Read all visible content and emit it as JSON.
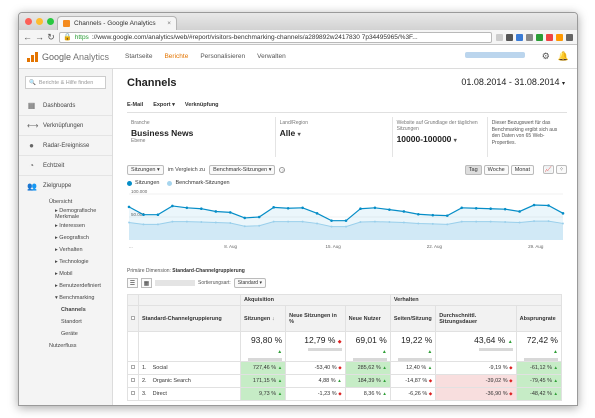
{
  "browser": {
    "tab_title": "Channels - Google Analytics",
    "url_https": "https",
    "url_rest": "://www.google.com/analytics/web/#report/visitors-benchmarking-channels/a289892w2417830 7p34495965/%3F...",
    "colors": {
      "close": "#fc5f57",
      "min": "#fdbc2e",
      "max": "#28c840"
    }
  },
  "ga": {
    "logo_main": "Google",
    "logo_sub": "Analytics",
    "nav": [
      "Startseite",
      "Berichte",
      "Personalisieren",
      "Verwalten"
    ],
    "active_nav": "Berichte",
    "accent": "#e37400"
  },
  "sidebar": {
    "search_placeholder": "Berichte & Hilfe finden",
    "items": [
      {
        "label": "Dashboards",
        "icon": "grid-icon"
      },
      {
        "label": "Verknüpfungen",
        "icon": "link-icon"
      },
      {
        "label": "Radar-Ereignisse",
        "icon": "pin-icon"
      },
      {
        "label": "Echtzeit",
        "icon": "clock-icon"
      },
      {
        "label": "Zielgruppe",
        "icon": "users-icon"
      }
    ],
    "sub": [
      {
        "label": "Übersicht",
        "level": 1
      },
      {
        "label": "▸ Demografische Merkmale",
        "level": 2
      },
      {
        "label": "▸ Interessen",
        "level": 2
      },
      {
        "label": "▸ Geografisch",
        "level": 2
      },
      {
        "label": "▸ Verhalten",
        "level": 2
      },
      {
        "label": "▸ Technologie",
        "level": 2
      },
      {
        "label": "▸ Mobil",
        "level": 2
      },
      {
        "label": "▸ Benutzerdefiniert",
        "level": 2
      },
      {
        "label": "▾ Benchmarking",
        "level": 2
      },
      {
        "label": "Channels",
        "level": 3,
        "selected": true
      },
      {
        "label": "Standort",
        "level": 3
      },
      {
        "label": "Geräte",
        "level": 3
      },
      {
        "label": "Nutzerfluss",
        "level": 1
      }
    ]
  },
  "main": {
    "title": "Channels",
    "date_range": "01.08.2014 - 31.08.2014",
    "toolbar": [
      "E-Mail",
      "Export ▾",
      "Verknüpfung"
    ],
    "filters": {
      "branche_label": "Branche",
      "branche_value": "Business News",
      "branche_sub": "Ebene",
      "land_label": "Land/Region",
      "land_value": "Alle",
      "sitzungen_label": "Website auf Grundlage der täglichen Sitzungen",
      "sitzungen_value": "10000-100000",
      "note": "Dieser Bezugswert für das Benchmarking ergibt sich aus den Daten von 65 Web-Properties."
    },
    "compare": {
      "metric1": "Sitzungen",
      "vs": "im Vergleich zu",
      "metric2": "Benchmark-Sitzungen"
    },
    "granularity": [
      "Tag",
      "Woche",
      "Monat"
    ],
    "active_granularity": "Tag",
    "legend": [
      {
        "label": "Sitzungen",
        "color": "#058dc7"
      },
      {
        "label": "Benchmark-Sitzungen",
        "color": "#a7d5ee"
      }
    ],
    "primary_dim_label": "Primäre Dimension:",
    "primary_dim_value": "Standard-Channelgruppierung",
    "sort_type_label": "Sortierungsart:",
    "sort_type_value": "Standard ▾",
    "table": {
      "groups": [
        "Akquisition",
        "Verhalten"
      ],
      "dim_header": "Standard-Channelgruppierung",
      "metric_headers": [
        "Sitzungen",
        "Neue Sitzungen in %",
        "Neue Nutzer",
        "Seiten/Sitzung",
        "Durchschnittl. Sitzungsdauer",
        "Absprungrate"
      ],
      "totals": [
        "93,80 %",
        "12,79 %",
        "69,01 %",
        "19,22 %",
        "43,64 %",
        "72,42 %"
      ],
      "total_dirs": [
        "up",
        "down",
        "up",
        "up",
        "up",
        "up"
      ],
      "rows": [
        {
          "idx": "1.",
          "name": "Social",
          "cells": [
            "727,46 %",
            "-53,40 %",
            "285,62 %",
            "12,40 %",
            "-9,19 %",
            "-61,12 %"
          ],
          "dirs": [
            "up",
            "down",
            "up",
            "up",
            "down",
            "up"
          ],
          "bg": [
            "g",
            "",
            "g",
            "",
            "",
            "g"
          ]
        },
        {
          "idx": "2.",
          "name": "Organic Search",
          "cells": [
            "171,15 %",
            "4,88 %",
            "184,39 %",
            "-14,87 %",
            "-39,02 %",
            "-79,45 %"
          ],
          "dirs": [
            "up",
            "up",
            "up",
            "down",
            "down",
            "up"
          ],
          "bg": [
            "g",
            "",
            "g",
            "",
            "r",
            "g"
          ]
        },
        {
          "idx": "3.",
          "name": "Direct",
          "cells": [
            "9,73 %",
            "-1,23 %",
            "8,36 %",
            "-6,26 %",
            "-36,90 %",
            "-48,42 %"
          ],
          "dirs": [
            "up",
            "down",
            "up",
            "down",
            "down",
            "up"
          ],
          "bg": [
            "g",
            "",
            "",
            "",
            "r",
            "g"
          ]
        }
      ]
    }
  },
  "chart_data": {
    "type": "line",
    "x": [
      "1. Aug",
      "2. Aug",
      "3. Aug",
      "4. Aug",
      "5. Aug",
      "6. Aug",
      "7. Aug",
      "8. Aug",
      "9. Aug",
      "10. Aug",
      "11. Aug",
      "12. Aug",
      "13. Aug",
      "14. Aug",
      "15. Aug",
      "16. Aug",
      "17. Aug",
      "18. Aug",
      "19. Aug",
      "20. Aug",
      "21. Aug",
      "22. Aug",
      "23. Aug",
      "24. Aug",
      "25. Aug",
      "26. Aug",
      "27. Aug",
      "28. Aug",
      "29. Aug",
      "30. Aug",
      "31. Aug"
    ],
    "xticks": [
      "...",
      "8. Aug",
      "15. Aug",
      "22. Aug",
      "29. Aug"
    ],
    "yticks": [
      "100.000",
      "50.000"
    ],
    "ylim": [
      0,
      100000
    ],
    "series": [
      {
        "name": "Sitzungen",
        "values": [
          72000,
          55000,
          55000,
          74000,
          70000,
          68000,
          62000,
          60000,
          48000,
          50000,
          71000,
          69000,
          70000,
          58000,
          42000,
          42000,
          68000,
          70000,
          66000,
          62000,
          56000,
          54000,
          53000,
          70000,
          69000,
          68000,
          67000,
          62000,
          76000,
          75000,
          58000
        ]
      },
      {
        "name": "Benchmark-Sitzungen",
        "values": [
          38000,
          34000,
          34000,
          40000,
          40000,
          39000,
          38000,
          37000,
          30000,
          31000,
          40000,
          40000,
          40000,
          36000,
          29000,
          29000,
          39000,
          40000,
          39000,
          38000,
          36000,
          35000,
          34000,
          40000,
          40000,
          40000,
          39000,
          38000,
          41000,
          41000,
          36000
        ]
      }
    ]
  }
}
